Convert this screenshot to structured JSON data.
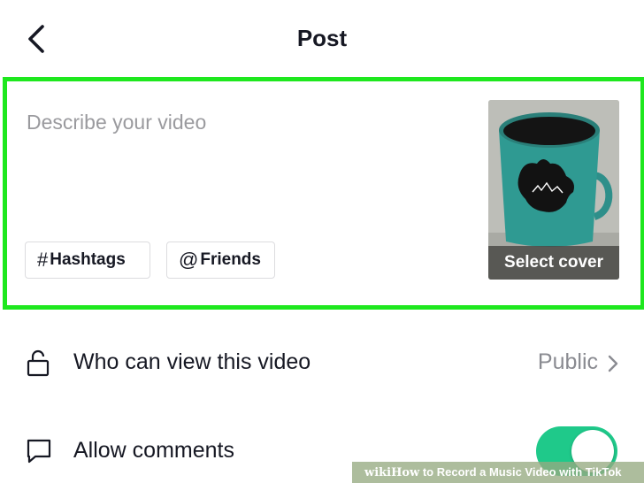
{
  "header": {
    "title": "Post"
  },
  "compose": {
    "caption_placeholder": "Describe your video",
    "hashtag_glyph": "#",
    "hashtag_label": "Hashtags",
    "friends_glyph": "@",
    "friends_label": "Friends",
    "cover_label": "Select cover"
  },
  "settings": {
    "privacy": {
      "label": "Who can view this video",
      "value": "Public"
    },
    "comments": {
      "label": "Allow comments",
      "enabled": true
    }
  },
  "banner": {
    "brand_prefix": "wiki",
    "brand_how": "How",
    "text": " to Record a Music Video with TikTok"
  },
  "colors": {
    "highlight": "#1ee81e",
    "toggle_on": "#1fc98a",
    "text_primary": "#161823",
    "text_secondary": "#8a8b91"
  },
  "icons": {
    "back": "chevron-left-icon",
    "privacy": "unlock-icon",
    "comments": "comment-icon",
    "chevron": "chevron-right-icon"
  }
}
